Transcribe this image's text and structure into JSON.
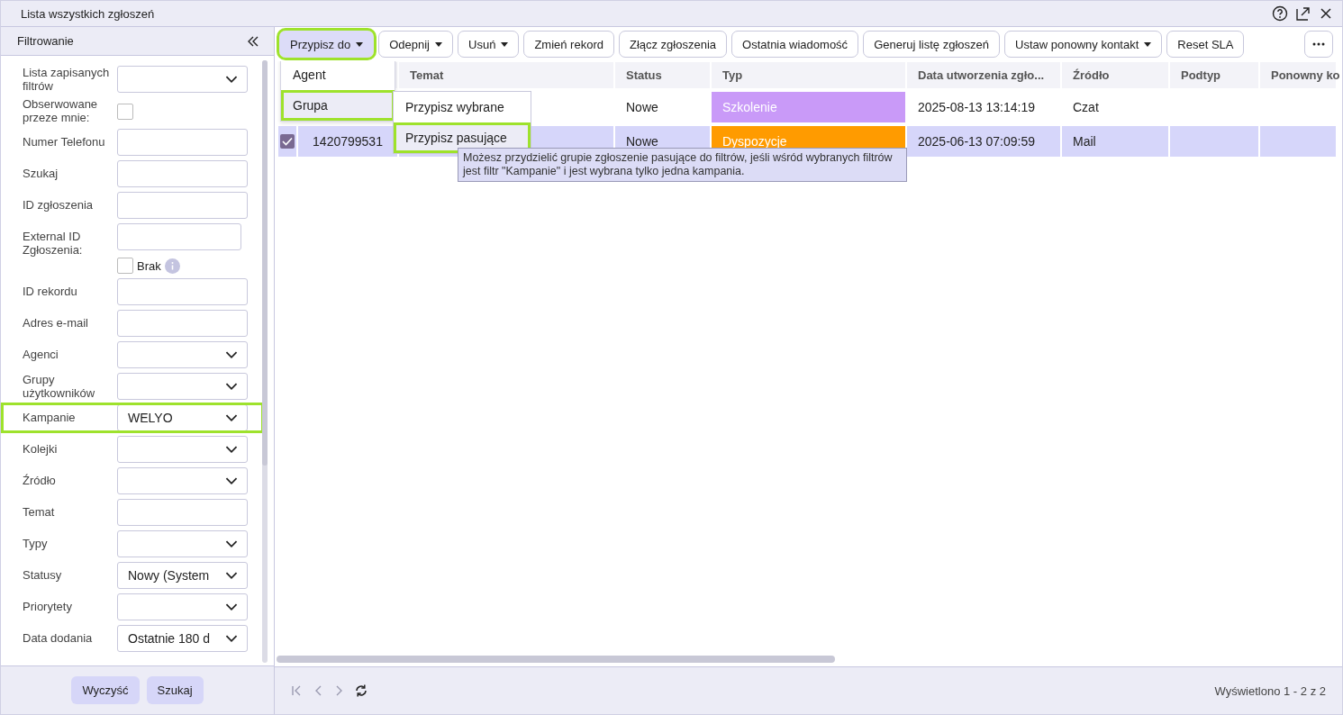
{
  "window": {
    "title": "Lista wszystkich zgłoszeń"
  },
  "filter_panel": {
    "title": "Filtrowanie",
    "filters": [
      {
        "label": "Lista zapisanych filtrów",
        "kind": "select",
        "highlighted": false
      },
      {
        "label": "Obserwowane przeze mnie:",
        "kind": "checkbox",
        "checked": false,
        "highlighted": false
      },
      {
        "label": "Numer Telefonu",
        "kind": "input",
        "highlighted": false
      },
      {
        "label": "Szukaj",
        "kind": "input",
        "highlighted": false
      },
      {
        "label": "ID zgłoszenia",
        "kind": "input",
        "highlighted": false
      },
      {
        "label": "External ID Zgłoszenia:",
        "kind": "input_with_checkbox",
        "checkbox_label": "Brak",
        "checked": false,
        "highlighted": false
      },
      {
        "label": "ID rekordu",
        "kind": "input",
        "highlighted": false
      },
      {
        "label": "Adres e-mail",
        "kind": "input",
        "highlighted": false
      },
      {
        "label": "Agenci",
        "kind": "select",
        "highlighted": false
      },
      {
        "label": "Grupy użytkowników",
        "kind": "select",
        "highlighted": false
      },
      {
        "label": "Kampanie",
        "kind": "select",
        "value": "WELYO",
        "highlighted": true
      },
      {
        "label": "Kolejki",
        "kind": "select",
        "highlighted": false
      },
      {
        "label": "Źródło",
        "kind": "select",
        "highlighted": false
      },
      {
        "label": "Temat",
        "kind": "input",
        "highlighted": false
      },
      {
        "label": "Typy",
        "kind": "select",
        "highlighted": false
      },
      {
        "label": "Statusy",
        "kind": "select",
        "value": "Nowy (System",
        "highlighted": false
      },
      {
        "label": "Priorytety",
        "kind": "select",
        "highlighted": false
      },
      {
        "label": "Data dodania",
        "kind": "select",
        "value": "Ostatnie 180 d",
        "highlighted": false
      }
    ],
    "buttons": [
      "Wyczyść",
      "Szukaj"
    ]
  },
  "toolbar": [
    {
      "label": "Przypisz do",
      "caret": true,
      "selected": true,
      "highlighted": true
    },
    {
      "label": "Odepnij",
      "caret": true,
      "selected": false,
      "highlighted": false
    },
    {
      "label": "Usuń",
      "caret": true,
      "selected": false,
      "highlighted": false
    },
    {
      "label": "Zmień rekord",
      "caret": false,
      "selected": false,
      "highlighted": false
    },
    {
      "label": "Złącz zgłoszenia",
      "caret": false,
      "selected": false,
      "highlighted": false
    },
    {
      "label": "Ostatnia wiadomość",
      "caret": false,
      "selected": false,
      "highlighted": false
    },
    {
      "label": "Generuj listę zgłoszeń",
      "caret": false,
      "selected": false,
      "highlighted": false
    },
    {
      "label": "Ustaw ponowny kontakt",
      "caret": true,
      "selected": false,
      "highlighted": false
    },
    {
      "label": "Reset SLA",
      "caret": false,
      "selected": false,
      "highlighted": false
    }
  ],
  "table": {
    "columns": [
      "",
      "Temat",
      "Status",
      "Typ",
      "Data utworzenia zgło...",
      "Źródło",
      "Podtyp",
      "Ponowny ko"
    ],
    "rows": [
      {
        "selected": false,
        "id": "",
        "status": "Nowe",
        "type": "Szkolenie",
        "color": "#c99af8",
        "created": "2025-08-13 13:14:19",
        "source": "Czat"
      },
      {
        "selected": true,
        "checked": true,
        "id": "1420799531",
        "status": "Nowe",
        "type": "Dyspozycje",
        "color": "#ff9b00",
        "created": "2025-06-13 07:09:59",
        "source": "Mail"
      }
    ]
  },
  "assign_menu": {
    "items": [
      {
        "label": "Agent",
        "selected": false,
        "highlighted": false
      },
      {
        "label": "Grupa",
        "selected": true,
        "highlighted": true
      }
    ],
    "submenu": [
      {
        "label": "Przypisz wybrane",
        "selected": false,
        "highlighted": false
      },
      {
        "label": "Przypisz pasujące",
        "selected": true,
        "highlighted": true
      }
    ],
    "tooltip": "Możesz przydzielić grupie zgłoszenie pasujące do filtrów, jeśli wśród wybranych filtrów jest filtr \"Kampanie\" i jest wybrana tylko jedna kampania."
  },
  "pager": {
    "summary": "Wyświetlono 1 - 2 z 2"
  }
}
